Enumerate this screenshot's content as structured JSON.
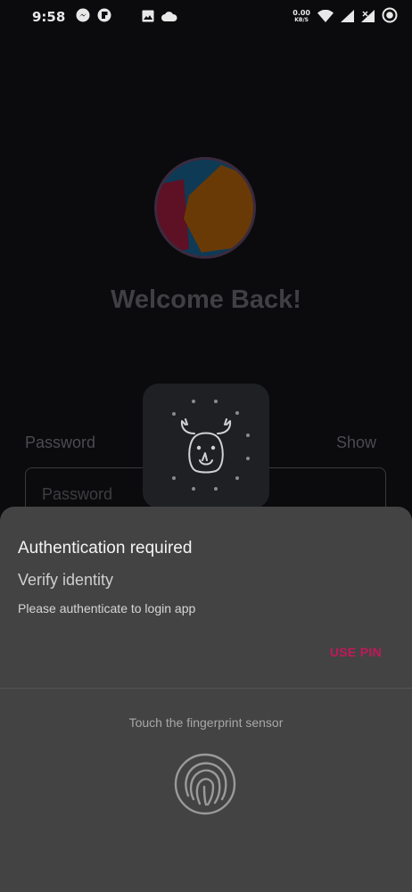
{
  "status_bar": {
    "time": "9:58",
    "net_speed": "0.00",
    "net_unit": "KB/S",
    "icons": [
      "messenger-icon",
      "app-icon",
      "image-icon",
      "cloud-icon",
      "wifi-icon",
      "signal-icon",
      "signal-off-icon",
      "record-icon"
    ]
  },
  "login": {
    "heading": "Welcome Back!",
    "password_label": "Password",
    "show_label": "Show",
    "password_placeholder": "Password"
  },
  "auth_sheet": {
    "title": "Authentication required",
    "subtitle": "Verify identity",
    "description": "Please authenticate to login app",
    "use_pin_label": "USE PIN",
    "fingerprint_hint": "Touch the fingerprint sensor",
    "fingerprint_icon": "fingerprint-icon"
  },
  "colors": {
    "accent": "#c2185b",
    "sheet_bg": "#434343",
    "screen_bg": "#0b0b0d"
  }
}
